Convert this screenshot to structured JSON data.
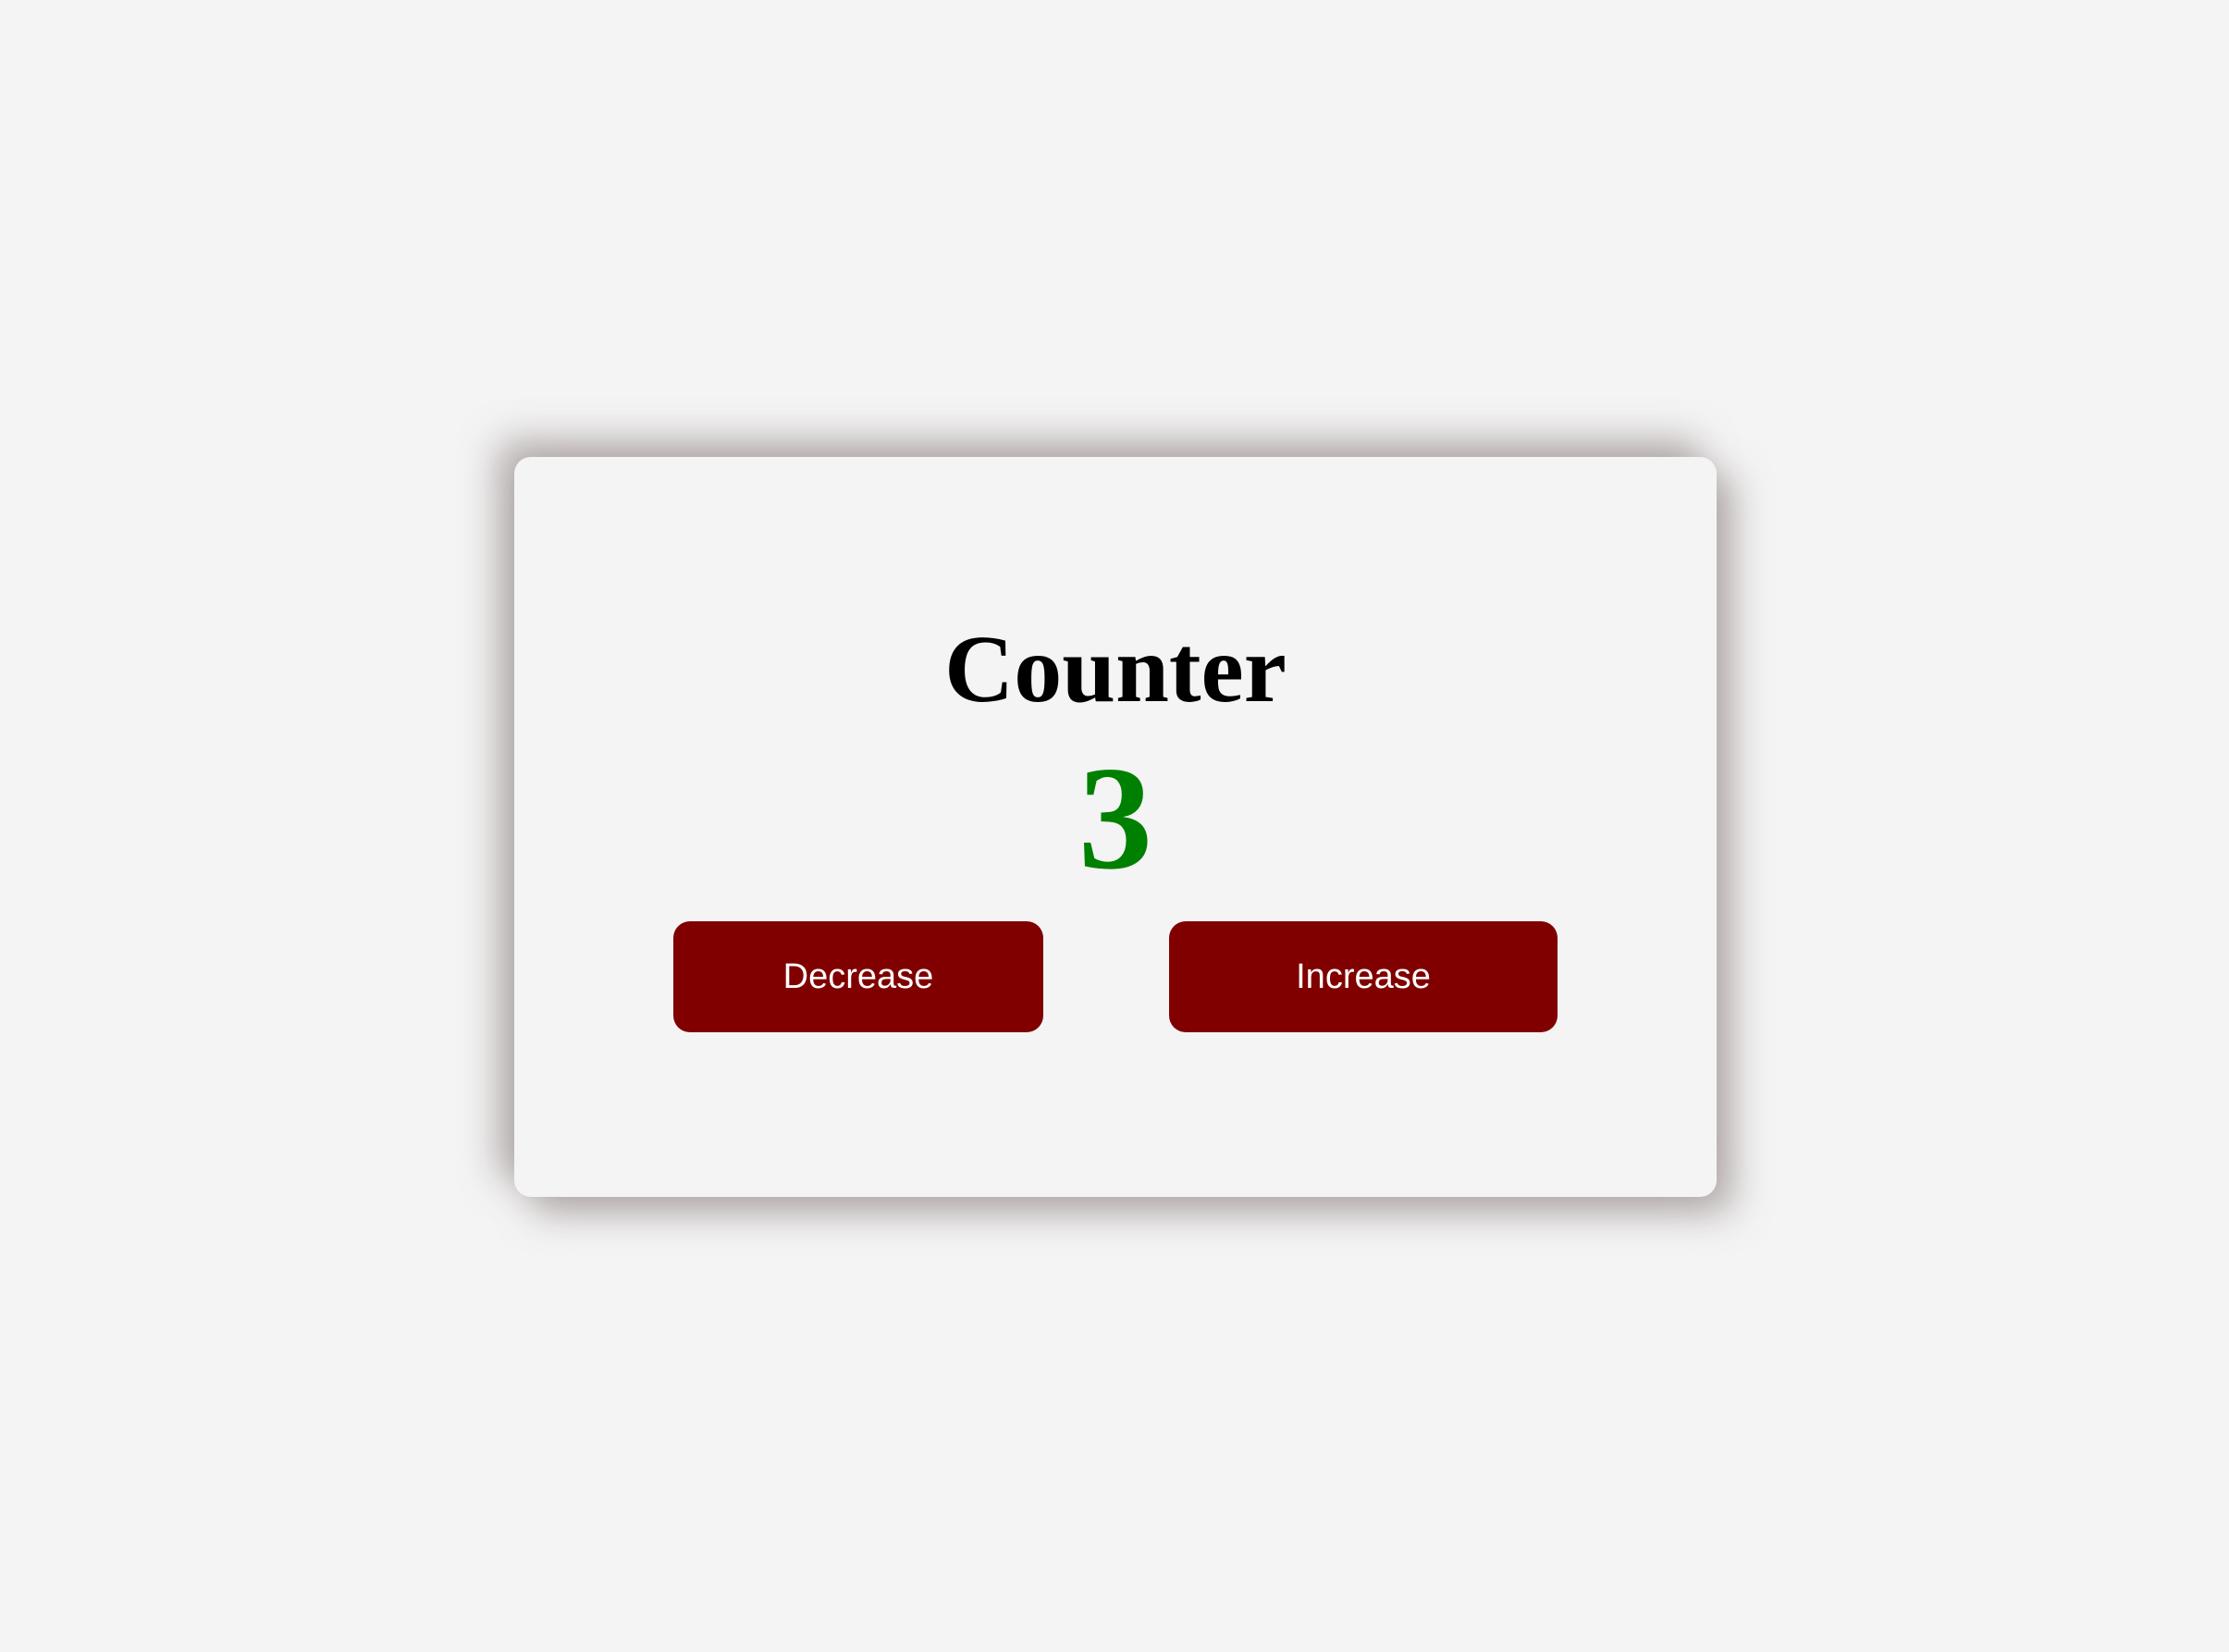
{
  "counter": {
    "title": "Counter",
    "value": "3"
  },
  "buttons": {
    "decrease_label": "Decrease",
    "increase_label": "Increase"
  },
  "colors": {
    "page_background": "#f4f4f4",
    "card_background": "#f4f4f4",
    "value_color": "#008000",
    "button_background": "#800000",
    "button_text": "#ffffff"
  }
}
